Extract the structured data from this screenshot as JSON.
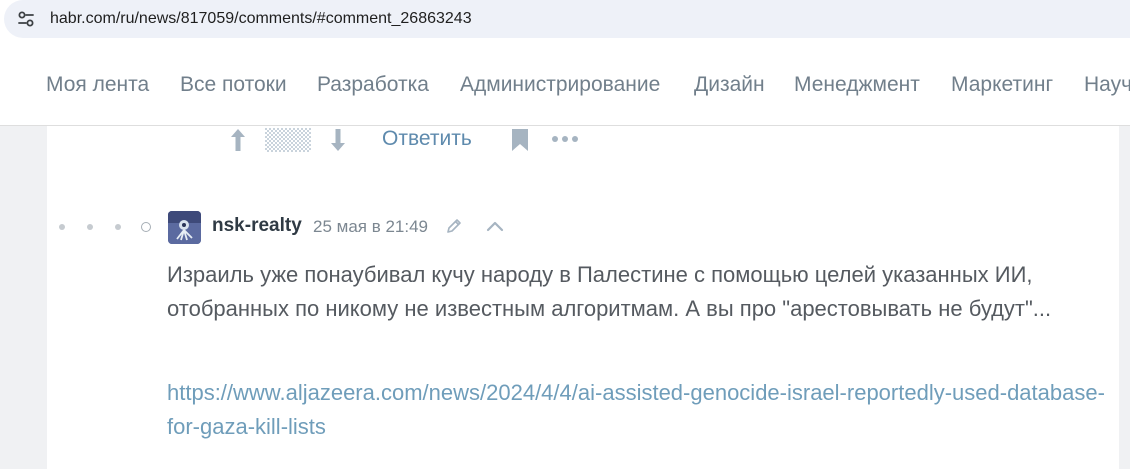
{
  "browser": {
    "url": "habr.com/ru/news/817059/comments/#comment_26863243",
    "site_info_icon": "tune-icon"
  },
  "nav": {
    "items": [
      {
        "label": "Моя лента"
      },
      {
        "label": "Все потоки"
      },
      {
        "label": "Разработка"
      },
      {
        "label": "Администрирование"
      },
      {
        "label": "Дизайн"
      },
      {
        "label": "Менеджмент"
      },
      {
        "label": "Маркетинг"
      },
      {
        "label": "Науч"
      }
    ]
  },
  "prev_comment_actions": {
    "reply_label": "Ответить",
    "icons": [
      "arrow-up-icon",
      "rating-hidden-icon",
      "arrow-down-icon",
      "bookmark-icon",
      "more-icon"
    ]
  },
  "comment": {
    "username": "nsk-realty",
    "date": "25 мая в 21:49",
    "text": "Израиль уже понаубивал кучу народу в Палестине с помощью целей указанных ИИ, отобранных по никому не известным алгоритмам. А вы про \"арестовывать не будут\"...",
    "link": "https://www.aljazeera.com/news/2024/4/4/ai-assisted-genocide-israel-reportedly-used-database-for-gaza-kill-lists"
  },
  "colors": {
    "nav_text": "#717f8b",
    "link": "#6f9dba",
    "reply": "#5e8aad",
    "icon": "#a6b4c1"
  }
}
